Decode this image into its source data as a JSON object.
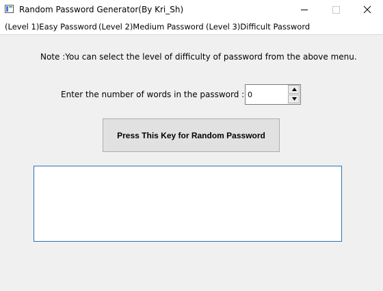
{
  "window": {
    "title": "Random Password Generator(By Kri_Sh)"
  },
  "menu": {
    "items": [
      {
        "label": "(Level 1)Easy Password"
      },
      {
        "label": "(Level 2)Medium Password"
      },
      {
        "label": "(Level 3)Difficult Password"
      }
    ]
  },
  "main": {
    "note": "Note :You can select the level of difficulty of password from the above menu.",
    "count_label": "Enter the number of words in the password :",
    "count_value": "0",
    "generate_label": "Press This Key for Random Password",
    "output_value": ""
  },
  "icons": {
    "app": "app-window-icon",
    "minimize": "minimize-icon",
    "maximize": "maximize-icon",
    "close": "close-icon",
    "spin_up": "arrow-up-icon",
    "spin_down": "arrow-down-icon"
  },
  "colors": {
    "window_bg": "#f0f0f0",
    "button_bg": "#e1e1e1",
    "focus_border": "#2a6fb6"
  }
}
